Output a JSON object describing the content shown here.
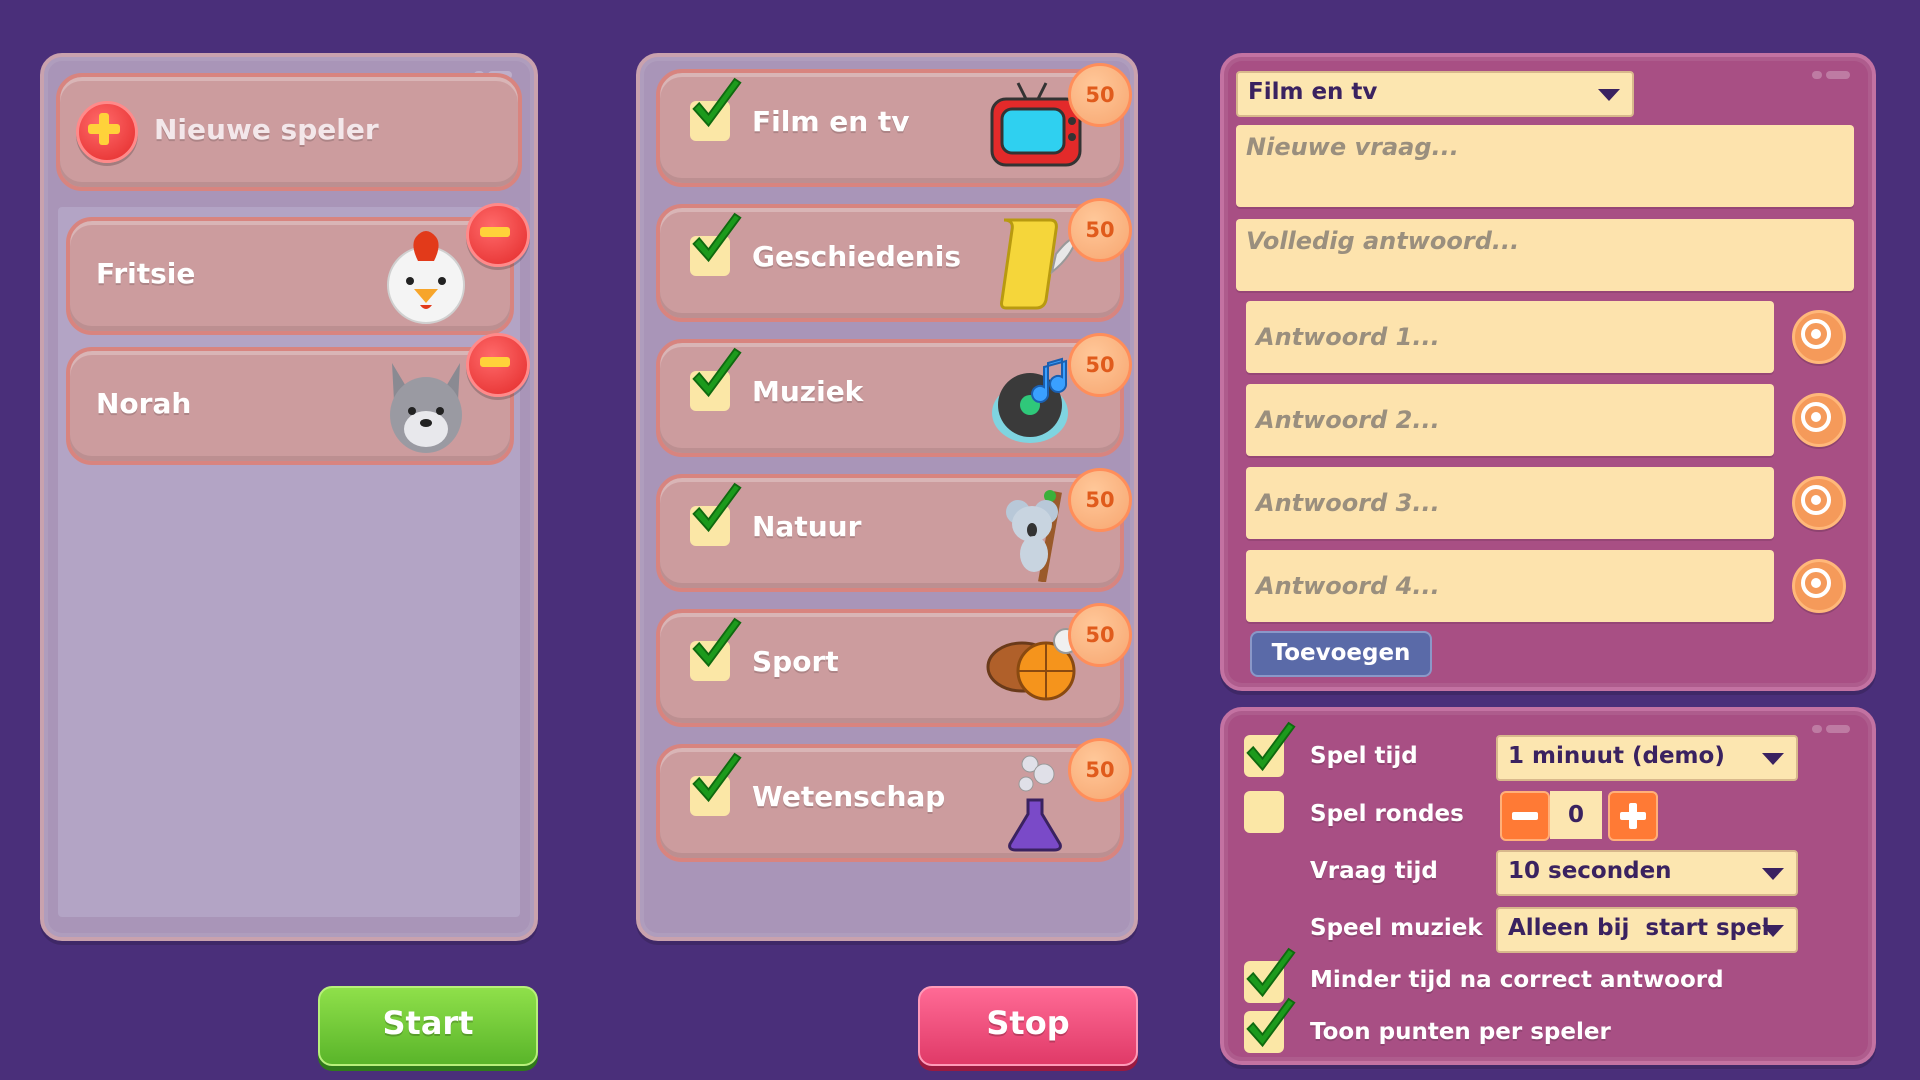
{
  "players": {
    "new_player_label": "Nieuwe speler",
    "list": [
      {
        "name": "Fritsie",
        "avatar": "chicken-icon"
      },
      {
        "name": "Norah",
        "avatar": "wolf-icon"
      }
    ]
  },
  "categories": [
    {
      "label": "Film en tv",
      "checked": true,
      "points": "50",
      "icon": "tv-icon"
    },
    {
      "label": "Geschiedenis",
      "checked": true,
      "points": "50",
      "icon": "scroll-quill-icon"
    },
    {
      "label": "Muziek",
      "checked": true,
      "points": "50",
      "icon": "vinyl-note-icon"
    },
    {
      "label": "Natuur",
      "checked": true,
      "points": "50",
      "icon": "koala-icon"
    },
    {
      "label": "Sport",
      "checked": true,
      "points": "50",
      "icon": "sports-balls-icon"
    },
    {
      "label": "Wetenschap",
      "checked": true,
      "points": "50",
      "icon": "flask-icon"
    }
  ],
  "question": {
    "category_select": "Film en tv",
    "new_question_placeholder": "Nieuwe vraag...",
    "full_answer_placeholder": "Volledig antwoord...",
    "answers": [
      "Antwoord 1...",
      "Antwoord 2...",
      "Antwoord 3...",
      "Antwoord 4..."
    ],
    "add_label": "Toevoegen"
  },
  "settings": {
    "game_time": {
      "label": "Spel tijd",
      "checked": true,
      "value": "1 minuut (demo)"
    },
    "game_rounds": {
      "label": "Spel rondes",
      "checked": false,
      "value": "0"
    },
    "question_time": {
      "label": "Vraag tijd",
      "value": "10 seconden"
    },
    "play_music": {
      "label": "Speel muziek",
      "value": "Alleen bij  start spel"
    },
    "less_time": {
      "label": "Minder tijd na correct antwoord",
      "checked": true
    },
    "show_points": {
      "label": "Toon punten per speler",
      "checked": true
    }
  },
  "buttons": {
    "start": "Start",
    "stop": "Stop"
  },
  "colors": {
    "background": "#4a2f7a",
    "start": "#6cc83a",
    "stop": "#ee4f7c",
    "accent": "#ff7a35"
  }
}
